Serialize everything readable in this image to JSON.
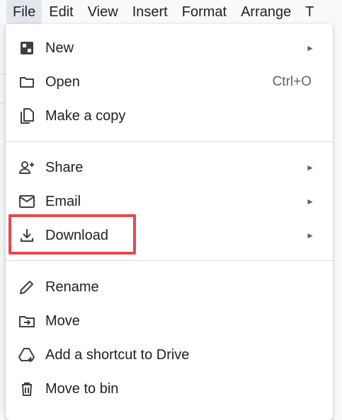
{
  "menubar": {
    "items": [
      "File",
      "Edit",
      "View",
      "Insert",
      "Format",
      "Arrange",
      "T"
    ]
  },
  "menu": {
    "items": [
      {
        "label": "New",
        "icon": "new-doc-icon",
        "has_submenu": true
      },
      {
        "label": "Open",
        "icon": "folder-icon",
        "shortcut": "Ctrl+O"
      },
      {
        "label": "Make a copy",
        "icon": "copy-icon"
      },
      {
        "label": "Share",
        "icon": "person-add-icon",
        "has_submenu": true
      },
      {
        "label": "Email",
        "icon": "email-icon",
        "has_submenu": true
      },
      {
        "label": "Download",
        "icon": "download-icon",
        "has_submenu": true,
        "highlighted": true
      },
      {
        "label": "Rename",
        "icon": "pencil-icon"
      },
      {
        "label": "Move",
        "icon": "folder-move-icon"
      },
      {
        "label": "Add a shortcut to Drive",
        "icon": "drive-shortcut-icon"
      },
      {
        "label": "Move to bin",
        "icon": "trash-icon"
      }
    ],
    "submenu_arrow": "►"
  },
  "colors": {
    "highlight_border": "#e8474f",
    "menu_bg": "#ffffff",
    "text": "#202124",
    "secondary_text": "#5f6368"
  }
}
